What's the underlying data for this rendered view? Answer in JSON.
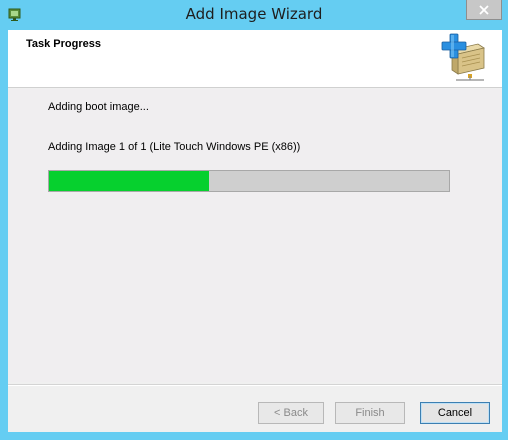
{
  "window": {
    "title": "Add Image Wizard"
  },
  "header": {
    "title": "Task Progress",
    "icon": "add-image-wizard-icon"
  },
  "content": {
    "status": "Adding boot image...",
    "detail": "Adding Image 1 of 1 (Lite Touch Windows PE (x86))",
    "progress_fraction": 0.4
  },
  "buttons": {
    "back": "< Back",
    "finish": "Finish",
    "cancel": "Cancel"
  },
  "colors": {
    "titlebar": "#65cdf2",
    "progress_fill": "#06d02e",
    "progress_track": "#cfcfcf"
  }
}
